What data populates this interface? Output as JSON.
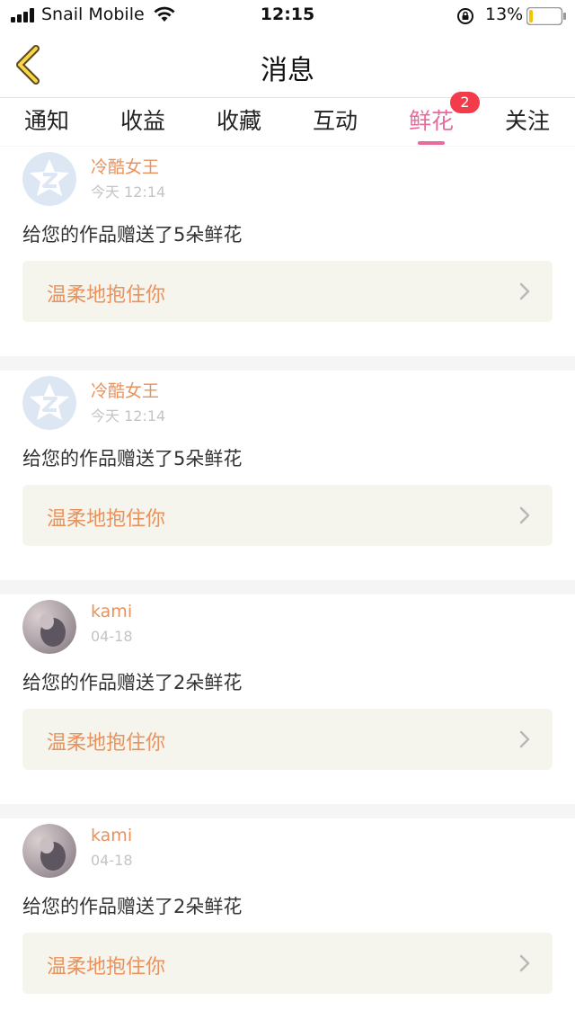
{
  "status_bar": {
    "carrier": "Snail Mobile",
    "time": "12:15",
    "battery": "13%",
    "battery_level": 0.13
  },
  "nav": {
    "title": "消息",
    "back_icon": "chevron-left-icon"
  },
  "tabs": [
    {
      "label": "通知"
    },
    {
      "label": "收益"
    },
    {
      "label": "收藏"
    },
    {
      "label": "互动"
    },
    {
      "label": "鲜花",
      "active": true
    },
    {
      "label": "关注"
    }
  ],
  "badge": "2",
  "colors": {
    "accent_pink": "#e86b9e",
    "username_orange": "#e8935e",
    "badge_red": "#f23b4b",
    "reply_bg": "#f5f4ed"
  },
  "messages": [
    {
      "user": "冷酷女王",
      "time": "今天 12:14",
      "text": "给您的作品赠送了5朵鲜花",
      "reply": "温柔地抱住你",
      "avatar": "default-avatar-icon"
    },
    {
      "user": "冷酷女王",
      "time": "今天 12:14",
      "text": "给您的作品赠送了5朵鲜花",
      "reply": "温柔地抱住你",
      "avatar": "default-avatar-icon"
    },
    {
      "user": "kami",
      "time": "04-18",
      "text": "给您的作品赠送了2朵鲜花",
      "reply": "温柔地抱住你",
      "avatar": "photo-avatar"
    },
    {
      "user": "kami",
      "time": "04-18",
      "text": "给您的作品赠送了2朵鲜花",
      "reply": "温柔地抱住你",
      "avatar": "photo-avatar"
    }
  ]
}
